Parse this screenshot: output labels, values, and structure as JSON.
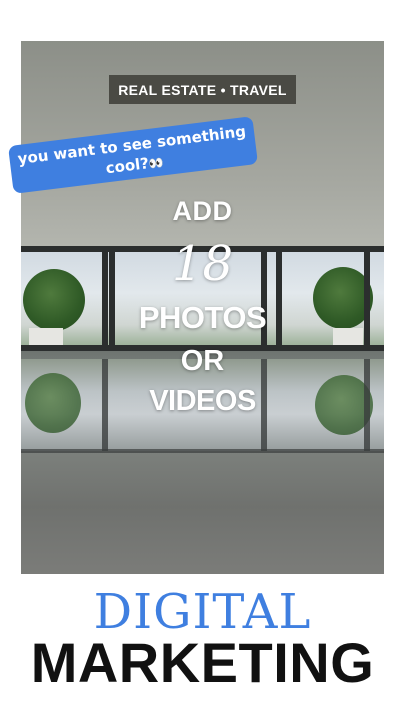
{
  "tag": {
    "text": "REAL ESTATE • TRAVEL"
  },
  "sticker": {
    "line1": "you want to see something",
    "line2": "cool?",
    "emoji": "👀"
  },
  "headline": {
    "add": "ADD",
    "number": "18",
    "photos": "PHOTOS",
    "or": "OR",
    "videos": "VIDEOS"
  },
  "footer": {
    "digital": "DIGITAL",
    "marketing": "MARKETING"
  },
  "colors": {
    "accent_blue": "#3f7fe0",
    "tag_bg": "#4a4a44",
    "text_dark": "#111111"
  }
}
